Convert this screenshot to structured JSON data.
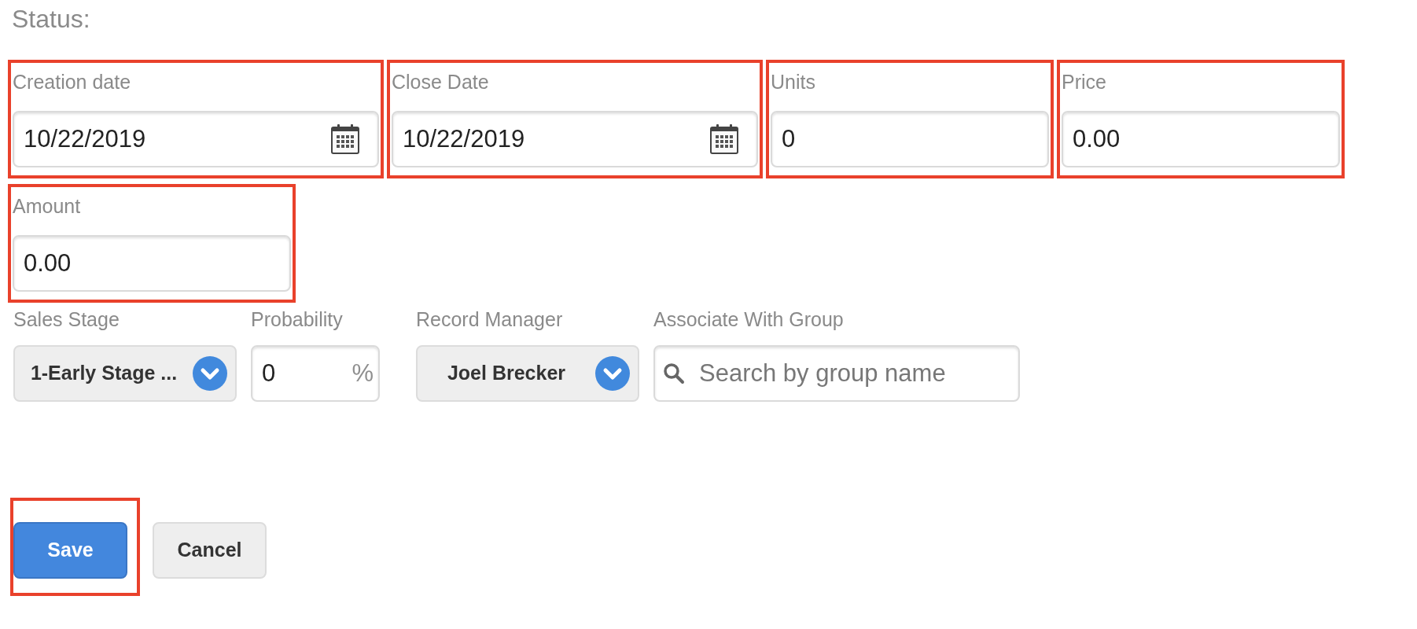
{
  "status_label": "Status:",
  "fields": [
    {
      "kind": "date",
      "label": "Creation date",
      "value": "10/22/2019",
      "highlighted": true
    },
    {
      "kind": "date",
      "label": "Close Date",
      "value": "10/22/2019",
      "highlighted": true
    },
    {
      "kind": "text",
      "label": "Units",
      "value": "0",
      "highlighted": true
    },
    {
      "kind": "text",
      "label": "Price",
      "value": "0.00",
      "highlighted": true
    },
    {
      "kind": "text",
      "label": "Amount",
      "value": "0.00",
      "highlighted": true
    }
  ],
  "details": [
    {
      "kind": "select",
      "label": "Sales Stage",
      "value": "1-Early Stage ..."
    },
    {
      "kind": "percent",
      "label": "Probability",
      "value": "0",
      "suffix": "%"
    },
    {
      "kind": "select",
      "label": "Record Manager",
      "value": "Joel Brecker"
    },
    {
      "kind": "search",
      "label": "Associate With Group",
      "placeholder": "Search by group name"
    }
  ],
  "buttons": [
    {
      "kind": "primary",
      "label": "Save",
      "highlighted": true
    },
    {
      "kind": "secondary",
      "label": "Cancel",
      "highlighted": false
    }
  ]
}
